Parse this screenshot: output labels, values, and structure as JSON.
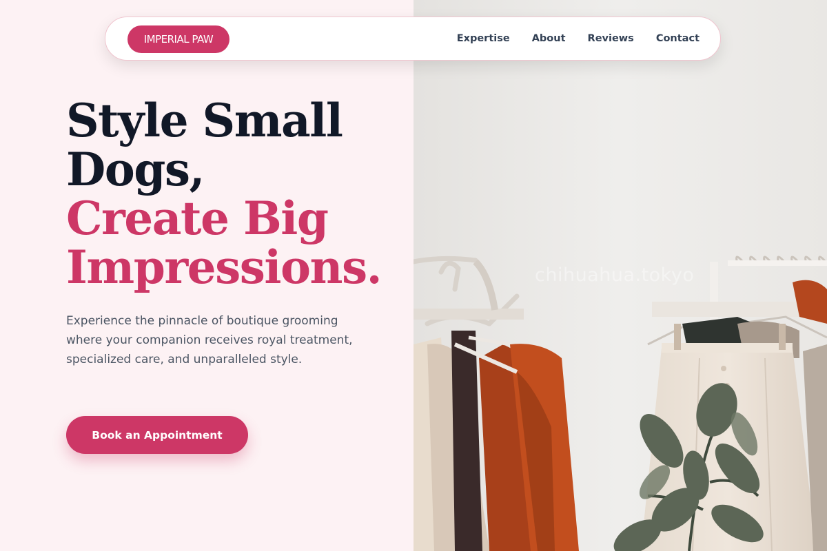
{
  "brand": {
    "logo_text": "IMPERIAL PAW",
    "accent_color": "#cd3766",
    "text_dark": "#111827"
  },
  "nav": {
    "items": [
      {
        "label": "Expertise"
      },
      {
        "label": "About"
      },
      {
        "label": "Reviews"
      },
      {
        "label": "Contact"
      }
    ]
  },
  "hero": {
    "headline_line1": "Style Small",
    "headline_line2": "Dogs,",
    "headline_line3": "Create Big",
    "headline_line4": "Impressions.",
    "subtext": "Experience the pinnacle of boutique grooming where your companion receives royal treatment, specialized care, and unparalleled style.",
    "cta_label": "Book an Appointment"
  },
  "image": {
    "watermark": "chihuahua.tokyo"
  }
}
